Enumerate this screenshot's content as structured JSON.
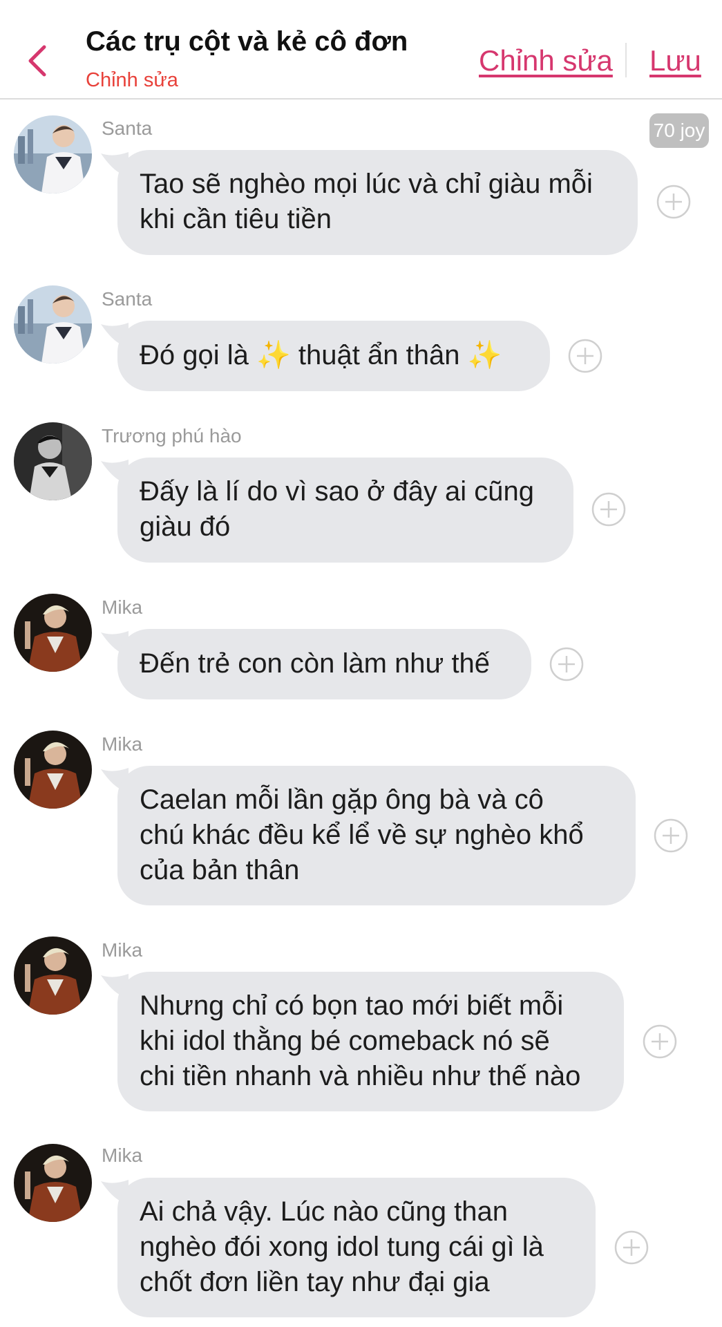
{
  "header": {
    "title": "Các trụ cột và kẻ cô đơn",
    "subtitle": "Chỉnh sửa",
    "edit_label": "Chỉnh sửa",
    "save_label": "Lưu"
  },
  "badge": {
    "label": "70 joy"
  },
  "messages": [
    {
      "sender": "Santa",
      "lines": [
        "Tao sẽ nghèo mọi lúc và chỉ giàu mỗi",
        "khi cần tiêu tiền"
      ]
    },
    {
      "sender": "Santa",
      "lines": [
        "Đó gọi là ✨ thuật ẩn thân ✨"
      ]
    },
    {
      "sender": "Trương phú hào",
      "lines": [
        "Đấy là lí do vì sao ở đây ai cũng",
        "giàu đó"
      ]
    },
    {
      "sender": "Mika",
      "lines": [
        "Đến trẻ con còn làm như thế"
      ]
    },
    {
      "sender": "Mika",
      "lines": [
        "Caelan mỗi lần gặp ông bà và  cô",
        "chú khác đều kể lể về sự nghèo khổ",
        "của bản thân"
      ]
    },
    {
      "sender": "Mika",
      "lines": [
        "Nhưng chỉ có bọn tao mới biết mỗi",
        "khi idol thằng bé comeback nó sẽ",
        "chi tiền nhanh và nhiều như thế nào"
      ]
    },
    {
      "sender": "Mika",
      "lines": [
        "Ai chả vậy. Lúc nào cũng than",
        "nghèo đói xong idol tung cái gì là",
        "chốt đơn liền tay như đại gia"
      ]
    }
  ],
  "colors": {
    "accent": "#d6376e",
    "subtitle": "#e8413a",
    "bubble": "#e6e7ea"
  }
}
